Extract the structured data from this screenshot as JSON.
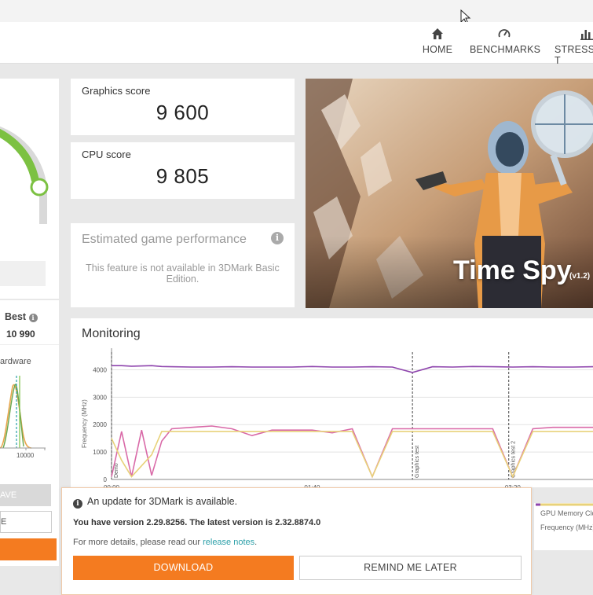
{
  "nav": {
    "home": "HOME",
    "benchmarks": "BENCHMARKS",
    "stress": "STRESS T"
  },
  "left_panel": {
    "best_label": "Best",
    "best_value": "10 990",
    "hardware_label": "ardware",
    "axis_tick": "10000",
    "save_label": "AVE",
    "second_button_label": "E"
  },
  "scores": {
    "graphics_label": "Graphics score",
    "graphics_value": "9 600",
    "cpu_label": "CPU score",
    "cpu_value": "9 805"
  },
  "estimated": {
    "title": "Estimated game performance",
    "body": "This feature is not available in 3DMark Basic Edition."
  },
  "hero": {
    "title": "Time Spy",
    "version": "(v1.2)"
  },
  "monitoring": {
    "title": "Monitoring",
    "ylabel": "Frequency (MHz)",
    "yticks": [
      "0",
      "1000",
      "2000",
      "3000",
      "4000"
    ],
    "xticks": [
      "00:00",
      "01:40",
      "03:20"
    ],
    "markers": [
      "Demo",
      "Graphics test",
      "Graphics test 2"
    ],
    "legend_gpu_memory": "GPU Memory Clo",
    "legend_frequency": "Frequency (MHz)"
  },
  "chart_data": {
    "type": "line",
    "xlabel": "",
    "ylabel": "Frequency (MHz)",
    "ylim": [
      0,
      4500
    ],
    "x": [
      0,
      5,
      10,
      15,
      20,
      25,
      30,
      40,
      50,
      60,
      70,
      80,
      90,
      100,
      110,
      120,
      130,
      140,
      150,
      160,
      170,
      180,
      190,
      200,
      210,
      220,
      230,
      240
    ],
    "series": [
      {
        "name": "",
        "color": "#8e44ad",
        "values": [
          4150,
          4150,
          4130,
          4140,
          4150,
          4120,
          4110,
          4100,
          4100,
          4110,
          4100,
          4100,
          4100,
          4120,
          4100,
          4100,
          4110,
          4100,
          3900,
          4110,
          4100,
          4120,
          4110,
          4100,
          4110,
          4100,
          4100,
          4110
        ]
      },
      {
        "name": "",
        "color": "#d96aa8",
        "values": [
          100,
          1750,
          100,
          1800,
          150,
          1400,
          1850,
          1900,
          1950,
          1850,
          1600,
          1800,
          1800,
          1800,
          1700,
          1850,
          100,
          1850,
          1850,
          1850,
          1850,
          1850,
          1850,
          100,
          1850,
          1900,
          1900,
          1900
        ]
      },
      {
        "name": "GPU Memory Clo",
        "color": "#e8d27a",
        "values": [
          1500,
          700,
          100,
          500,
          900,
          1750,
          1750,
          1750,
          1750,
          1750,
          1750,
          1750,
          1750,
          1750,
          1750,
          1750,
          100,
          1750,
          1750,
          1750,
          1750,
          1750,
          1750,
          100,
          1750,
          1750,
          1750,
          1750
        ]
      }
    ]
  },
  "update_popup": {
    "header": "An update for 3DMark is available.",
    "version_line": "You have version 2.29.8256. The latest version is 2.32.8874.0",
    "details_prefix": "For more details, please read our ",
    "details_link": "release notes",
    "details_suffix": ".",
    "download": "DOWNLOAD",
    "remind": "REMIND ME LATER"
  },
  "colors": {
    "accent_orange": "#f47b20",
    "gauge_green": "#7cc142",
    "link_teal": "#2a9fa8"
  }
}
